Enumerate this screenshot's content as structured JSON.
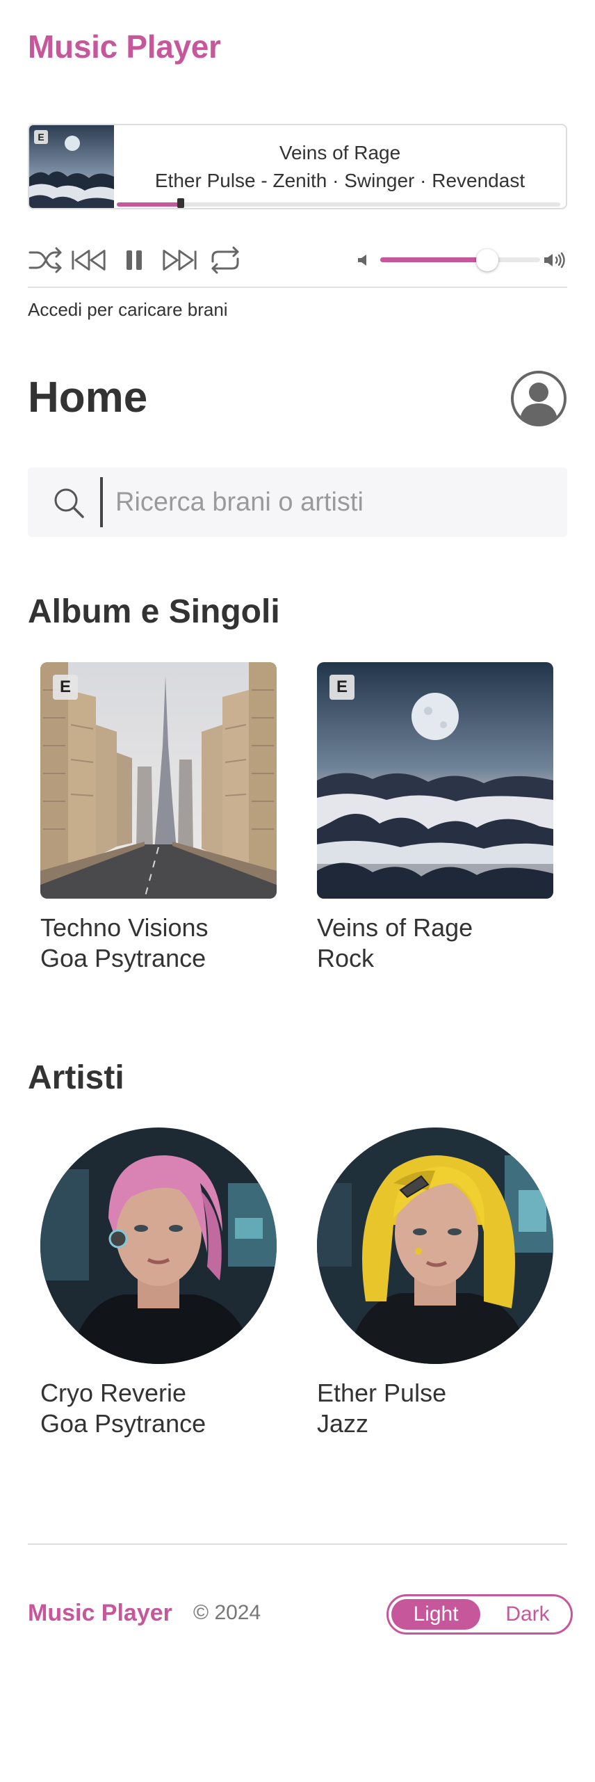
{
  "app": {
    "title": "Music Player"
  },
  "now_playing": {
    "explicit_badge": "E",
    "title": "Veins of Rage",
    "artists": "Ether Pulse - Zenith · Swinger · Revendast",
    "progress_fraction": 0.14
  },
  "controls": {
    "icons": [
      "shuffle-icon",
      "previous-icon",
      "pause-icon",
      "next-icon",
      "repeat-icon",
      "volume-low-icon",
      "volume-high-icon"
    ],
    "volume_fraction": 0.67
  },
  "login_hint": "Accedi per caricare brani",
  "home": {
    "title": "Home"
  },
  "search": {
    "placeholder": "Ricerca brani o artisti"
  },
  "albums": {
    "title": "Album e Singoli",
    "items": [
      {
        "title": "Techno Visions",
        "genre": "Goa Psytrance",
        "explicit_badge": "E"
      },
      {
        "title": "Veins of Rage",
        "genre": "Rock",
        "explicit_badge": "E"
      }
    ]
  },
  "artists": {
    "title": "Artisti",
    "items": [
      {
        "name": "Cryo Reverie",
        "genre": "Goa Psytrance"
      },
      {
        "name": "Ether Pulse",
        "genre": "Jazz"
      }
    ]
  },
  "footer": {
    "brand": "Music Player",
    "copyright": "© 2024",
    "theme_light": "Light",
    "theme_dark": "Dark"
  },
  "colors": {
    "accent": "#c7579b",
    "text": "#333333",
    "search_bg": "#f6f6f8"
  }
}
